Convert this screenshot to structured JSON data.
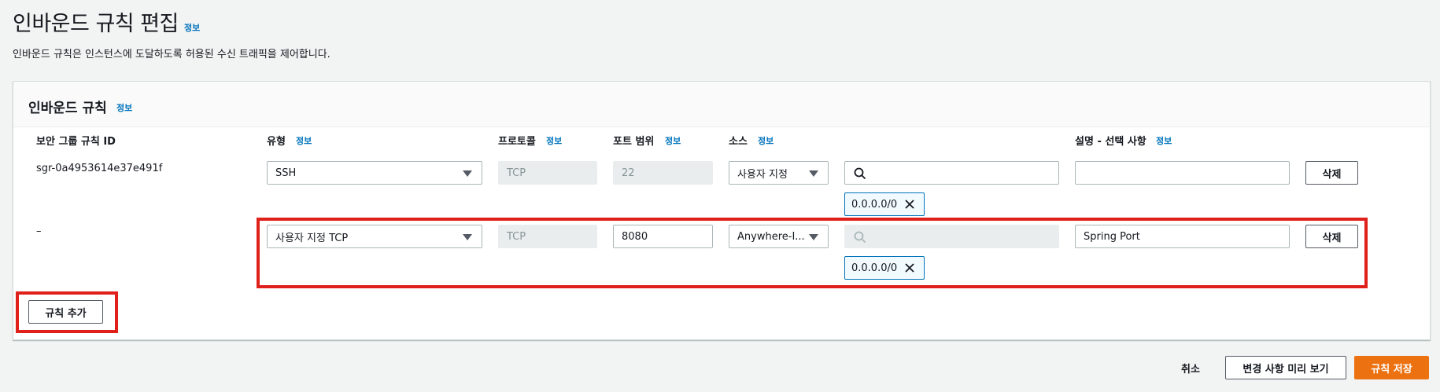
{
  "page": {
    "title": "인바운드 규칙 편집",
    "info": "정보",
    "description": "인바운드 규칙은 인스턴스에 도달하도록 허용된 수신 트래픽을 제어합니다."
  },
  "panel": {
    "title": "인바운드 규칙",
    "info": "정보",
    "columns": {
      "rule_id": "보안 그룹 규칙 ID",
      "type": "유형",
      "protocol": "프로토콜",
      "port_range": "포트 범위",
      "source": "소스",
      "description": "설명 - 선택 사항",
      "info": "정보"
    },
    "rows": [
      {
        "rule_id": "sgr-0a4953614e37e491f",
        "type": "SSH",
        "protocol": "TCP",
        "port_range": "22",
        "source": "사용자 지정",
        "search_value": "",
        "cidr": "0.0.0.0/0",
        "description": "",
        "delete_label": "삭제"
      },
      {
        "rule_id": "–",
        "type": "사용자 지정 TCP",
        "protocol": "TCP",
        "port_range": "8080",
        "source": "Anywhere-I...",
        "search_value": "",
        "cidr": "0.0.0.0/0",
        "description": "Spring Port",
        "delete_label": "삭제"
      }
    ],
    "add_rule_label": "규칙 추가"
  },
  "footer": {
    "cancel_label": "취소",
    "preview_label": "변경 사항 미리 보기",
    "save_label": "규칙 저장"
  },
  "colors": {
    "primary": "#ec7211",
    "link": "#0073bb",
    "highlight": "#e0201a"
  }
}
